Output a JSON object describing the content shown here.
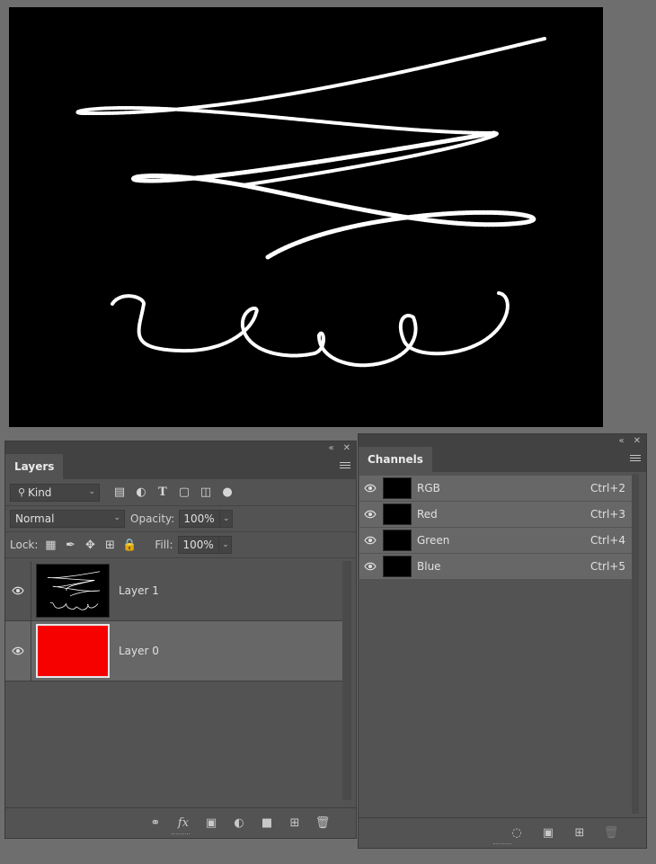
{
  "layers_panel": {
    "tab": "Layers",
    "filter": {
      "kind": "Kind"
    },
    "blend_mode": "Normal",
    "opacity_label": "Opacity:",
    "opacity_value": "100%",
    "lock_label": "Lock:",
    "fill_label": "Fill:",
    "fill_value": "100%",
    "layers": [
      {
        "name": "Layer 1",
        "thumbnail": "calligraphy-art",
        "visible": true,
        "selected": false
      },
      {
        "name": "Layer 0",
        "thumbnail": "red-fill",
        "visible": true,
        "selected": true
      }
    ],
    "footer_icons": [
      "link-icon",
      "fx-icon",
      "mask-icon",
      "adjustment-icon",
      "folder-icon",
      "new-layer-icon",
      "trash-icon"
    ]
  },
  "channels_panel": {
    "tab": "Channels",
    "channels": [
      {
        "name": "RGB",
        "shortcut": "Ctrl+2"
      },
      {
        "name": "Red",
        "shortcut": "Ctrl+3"
      },
      {
        "name": "Green",
        "shortcut": "Ctrl+4"
      },
      {
        "name": "Blue",
        "shortcut": "Ctrl+5"
      }
    ],
    "footer_icons": [
      "selection-icon",
      "mask-icon",
      "new-channel-icon",
      "trash-icon"
    ]
  },
  "colors": {
    "layer0_fill": "#f60000",
    "panel_bg": "#535353",
    "selected_row": "#676767"
  }
}
